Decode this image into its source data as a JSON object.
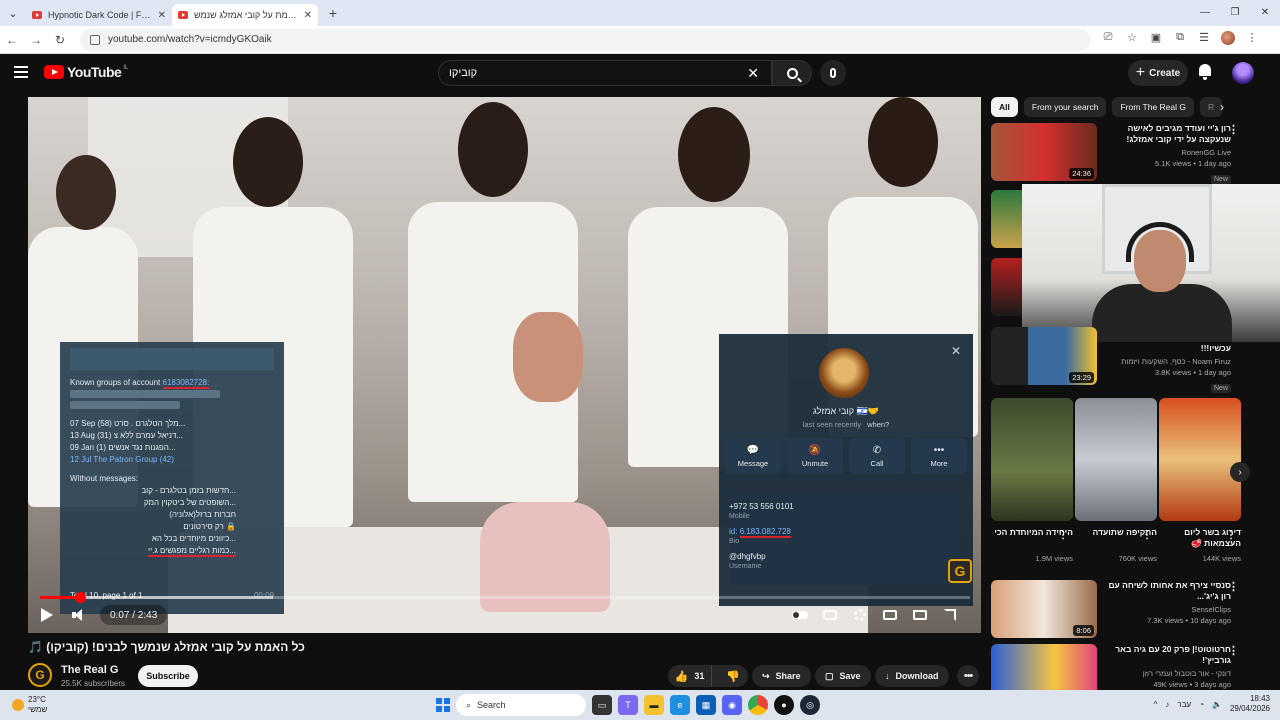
{
  "browser": {
    "tabs": [
      {
        "title": "Hypnotic Dark Code | Futuristi"
      },
      {
        "title": "כל האמת על קובי אמזלג שנמש"
      }
    ],
    "url": "youtube.com/watch?v=icmdyGKOaik"
  },
  "youtube": {
    "logo_text": "YouTube",
    "country_code": "IL",
    "search_value": "קוביקו",
    "create_label": "Create"
  },
  "overlay_left": {
    "heading": "Known groups of account",
    "account_id": "6183082728:",
    "entries": [
      "07 Sep (58) מלך הטלגרם . סרט...",
      "13 Aug (31) דניאל עמרם ללא צ...",
      "09 Jan (1) הפגנות נגד אנשים...",
      "12 Jul The Patron Group (42)"
    ],
    "without_label": "Without messages:",
    "without_entries": [
      "חדשות בזמן בטלגרם - קוב...",
      "השופטים של ביטקוין המק...",
      "חברות ברזל(אלוניה)",
      "רק סירטונים 🔒",
      "כיוונים מיוחדים בכל הא...",
      "כמות רגליים מפגשים ג.יי..."
    ],
    "total": "Total 10, page 1 of 1",
    "time": "00:09"
  },
  "overlay_right": {
    "name": "קובי אמזלג 🇮🇱🤝",
    "last_seen": "last seen recently",
    "when": "when?",
    "actions": [
      {
        "label": "Message",
        "icon": "message-icon"
      },
      {
        "label": "Unmute",
        "icon": "bell-off-icon"
      },
      {
        "label": "Call",
        "icon": "phone-icon"
      },
      {
        "label": "More",
        "icon": "more-icon"
      }
    ],
    "phone": "+972 53 556 0101",
    "phone_label": "Mobile",
    "id_prefix": "id:",
    "id_value": "6.183.082.728",
    "id_label": "Bio",
    "username": "@dhgfvbp",
    "username_label": "Username"
  },
  "player": {
    "time": "0:07 / 2:43",
    "progress_fraction": 0.043,
    "buffered_fraction": 0.25
  },
  "video": {
    "title": "כל האמת על קובי אמזלג שנמשך לבנים! (קוביקו) 🎵",
    "channel": "The Real G",
    "subscribers": "25.5K subscribers",
    "subscribe_label": "Subscribe",
    "likes": "31",
    "share_label": "Share",
    "save_label": "Save",
    "download_label": "Download"
  },
  "sidebar": {
    "chips": [
      "All",
      "From your search",
      "From The Real G",
      "R"
    ],
    "videos": [
      {
        "title": "רון ג'יי ועודד מגיבים לאישה שנעקצה על ידי קובי אמזלג! (עצוב)",
        "channel": "RonenGG Live",
        "stats": "5.1K views • 1 day ago",
        "badge": "New",
        "duration": "24:36"
      },
      {
        "title": "עכשיו!!!",
        "channel": "Noam Firuz - כסף, השקעות ויזמות",
        "stats": "3.8K views • 1 day ago",
        "badge": "New",
        "duration": "23:29"
      },
      {
        "title": "סנסיי צירף את אחותו לשיחה עם רון ג'יג'...",
        "channel": "SenselClips",
        "stats": "7.3K views • 10 days ago",
        "badge": "",
        "duration": "8:06"
      },
      {
        "title": "חרטוטוט!| פרק 20 עם גיה באר גורביץ'!",
        "channel": "דונקי - אור בוטבול ועמרי רוזן",
        "stats": "49K views • 3 days ago",
        "badge": "",
        "duration": ""
      }
    ],
    "shorts": [
      {
        "title": "היחידה המיוחדת הכי",
        "views": "1.9M views"
      },
      {
        "title": "התקיפה שתועדה",
        "views": "760K views"
      },
      {
        "title": "דירוג בשר ליום העצמאות 🥩",
        "views": "144K views"
      }
    ]
  },
  "taskbar": {
    "temperature": "23°C",
    "weather_text": "שמשי",
    "search_placeholder": "Search",
    "language": "עבר",
    "time": "18:43",
    "date": "29/04/2026"
  }
}
